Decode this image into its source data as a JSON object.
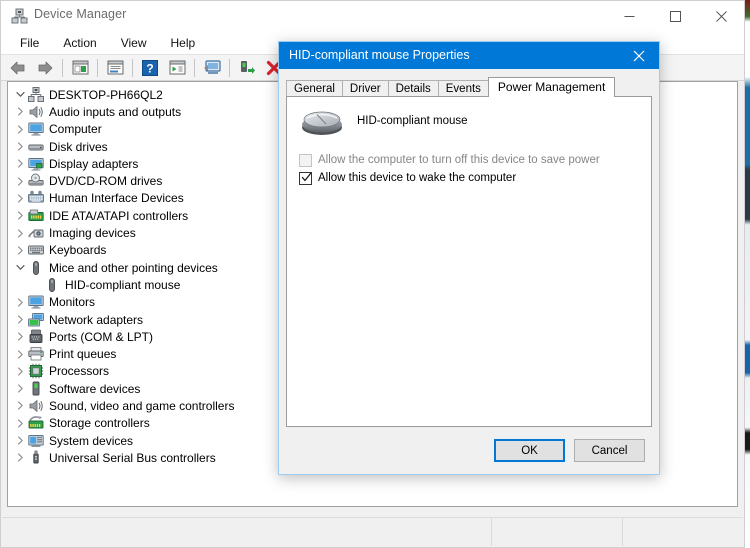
{
  "window": {
    "title": "Device Manager",
    "app_icon": "device-manager-icon",
    "controls": {
      "minimize": "minimize-icon",
      "maximize": "maximize-icon",
      "close": "close-icon"
    },
    "menu": [
      "File",
      "Action",
      "View",
      "Help"
    ],
    "toolbar": [
      {
        "name": "back-icon",
        "kind": "icon"
      },
      {
        "name": "forward-icon",
        "kind": "icon"
      },
      {
        "name": "separator",
        "kind": "sep"
      },
      {
        "name": "show-hide-console-tree-icon",
        "kind": "icon"
      },
      {
        "name": "separator",
        "kind": "sep"
      },
      {
        "name": "properties-icon",
        "kind": "icon"
      },
      {
        "name": "separator",
        "kind": "sep"
      },
      {
        "name": "help-icon",
        "kind": "icon"
      },
      {
        "name": "scan-for-hardware-changes-icon",
        "kind": "icon"
      },
      {
        "name": "separator",
        "kind": "sep"
      },
      {
        "name": "update-driver-icon",
        "kind": "icon"
      },
      {
        "name": "separator",
        "kind": "sep"
      },
      {
        "name": "enable-device-icon",
        "kind": "icon"
      },
      {
        "name": "uninstall-device-icon",
        "kind": "icon"
      },
      {
        "name": "disable-device-icon",
        "kind": "icon"
      }
    ],
    "statusbar": {
      "left": "",
      "middle": "",
      "right": ""
    }
  },
  "tree": {
    "root": {
      "label": "DESKTOP-PH66QL2",
      "icon": "computer-root-icon",
      "expanded": true
    },
    "nodes": [
      {
        "label": "Audio inputs and outputs",
        "icon": "speaker-icon",
        "expanded": false,
        "depth": 1
      },
      {
        "label": "Computer",
        "icon": "monitor-icon",
        "expanded": false,
        "depth": 1
      },
      {
        "label": "Disk drives",
        "icon": "disk-drive-icon",
        "expanded": false,
        "depth": 1
      },
      {
        "label": "Display adapters",
        "icon": "display-adapter-icon",
        "expanded": false,
        "depth": 1
      },
      {
        "label": "DVD/CD-ROM drives",
        "icon": "optical-drive-icon",
        "expanded": false,
        "depth": 1
      },
      {
        "label": "Human Interface Devices",
        "icon": "hid-icon",
        "expanded": false,
        "depth": 1
      },
      {
        "label": "IDE ATA/ATAPI controllers",
        "icon": "ide-controller-icon",
        "expanded": false,
        "depth": 1
      },
      {
        "label": "Imaging devices",
        "icon": "imaging-device-icon",
        "expanded": false,
        "depth": 1
      },
      {
        "label": "Keyboards",
        "icon": "keyboard-icon",
        "expanded": false,
        "depth": 1
      },
      {
        "label": "Mice and other pointing devices",
        "icon": "mouse-icon",
        "expanded": true,
        "depth": 1
      },
      {
        "label": "HID-compliant mouse",
        "icon": "mouse-icon",
        "expanded": null,
        "depth": 2
      },
      {
        "label": "Monitors",
        "icon": "monitor-icon",
        "expanded": false,
        "depth": 1
      },
      {
        "label": "Network adapters",
        "icon": "network-adapter-icon",
        "expanded": false,
        "depth": 1
      },
      {
        "label": "Ports (COM & LPT)",
        "icon": "port-icon",
        "expanded": false,
        "depth": 1
      },
      {
        "label": "Print queues",
        "icon": "printer-icon",
        "expanded": false,
        "depth": 1
      },
      {
        "label": "Processors",
        "icon": "processor-icon",
        "expanded": false,
        "depth": 1
      },
      {
        "label": "Software devices",
        "icon": "software-device-icon",
        "expanded": false,
        "depth": 1
      },
      {
        "label": "Sound, video and game controllers",
        "icon": "speaker-icon",
        "expanded": false,
        "depth": 1
      },
      {
        "label": "Storage controllers",
        "icon": "storage-controller-icon",
        "expanded": false,
        "depth": 1
      },
      {
        "label": "System devices",
        "icon": "system-device-icon",
        "expanded": false,
        "depth": 1
      },
      {
        "label": "Universal Serial Bus controllers",
        "icon": "usb-icon",
        "expanded": false,
        "depth": 1
      }
    ]
  },
  "dialog": {
    "title": "HID-compliant mouse Properties",
    "close_icon": "close-icon",
    "tabs": [
      {
        "label": "General",
        "active": false
      },
      {
        "label": "Driver",
        "active": false
      },
      {
        "label": "Details",
        "active": false
      },
      {
        "label": "Events",
        "active": false
      },
      {
        "label": "Power Management",
        "active": true
      }
    ],
    "device": {
      "icon": "mouse-device-icon",
      "name": "HID-compliant mouse"
    },
    "options": [
      {
        "label": "Allow the computer to turn off this device to save power",
        "checked": false,
        "enabled": false
      },
      {
        "label": "Allow this device to wake the computer",
        "checked": true,
        "enabled": true
      }
    ],
    "buttons": {
      "ok": "OK",
      "cancel": "Cancel"
    }
  },
  "colors": {
    "title_bar_accent": "#0078d7",
    "dialog_border": "#9ecbf0",
    "focus_border": "#0078d7",
    "window_bg": "#f0f0f0",
    "content_bg": "#ffffff",
    "disabled_text": "#868686"
  }
}
